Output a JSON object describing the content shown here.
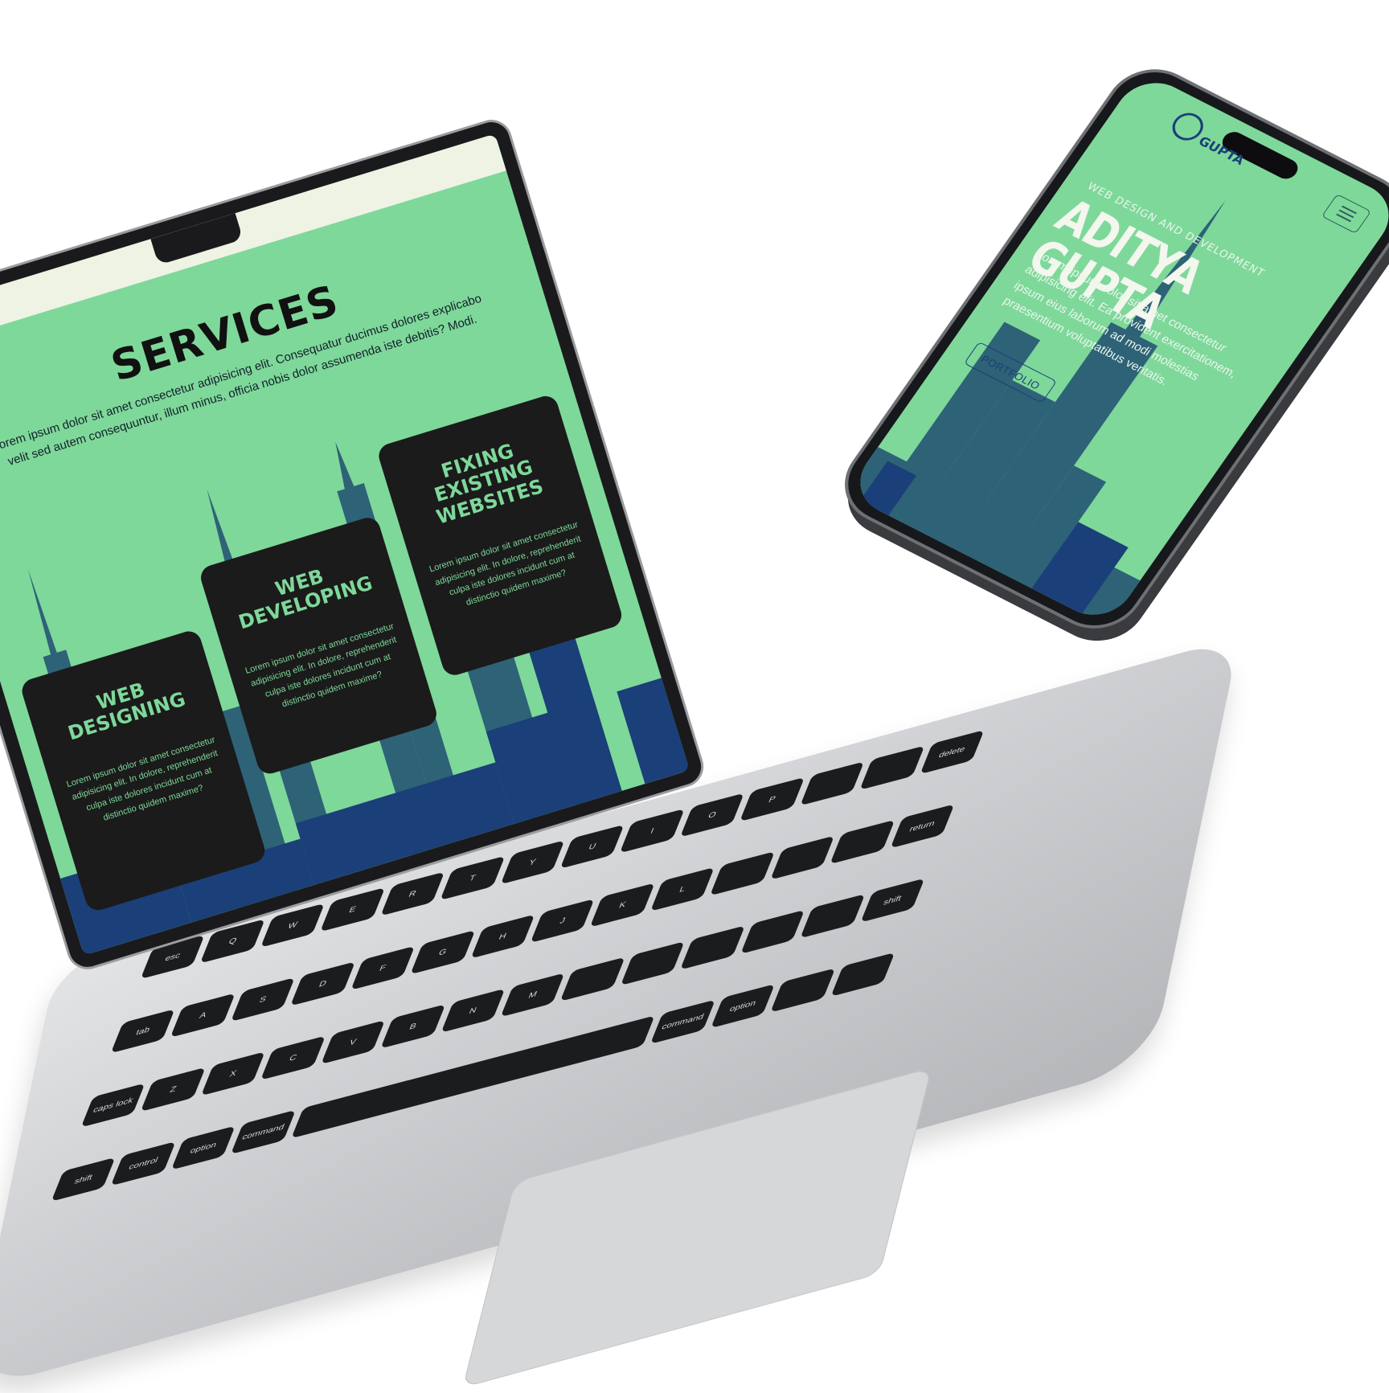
{
  "laptop": {
    "services": {
      "title": "SERVICES",
      "description": "Lorem ipsum dolor sit amet consectetur adipisicing elit. Consequatur ducimus dolores explicabo velit sed autem consequuntur, illum minus, officia nobis dolor assumenda iste debitis? Modi."
    },
    "cards": [
      {
        "title": "WEB DESIGNING",
        "text": "Lorem ipsum dolor sit amet consectetur adipisicing elit. In dolore, reprehenderit culpa iste dolores incidunt cum at distinctio quidem maxime?"
      },
      {
        "title": "WEB DEVELOPING",
        "text": "Lorem ipsum dolor sit amet consectetur adipisicing elit. In dolore, reprehenderit culpa iste dolores incidunt cum at distinctio quidem maxime?"
      },
      {
        "title": "FIXING EXISTING WEBSITES",
        "text": "Lorem ipsum dolor sit amet consectetur adipisicing elit. In dolore, reprehenderit culpa iste dolores incidunt cum at distinctio quidem maxime?"
      }
    ],
    "keys": [
      "esc",
      "tab",
      "caps lock",
      "shift",
      "control",
      "option",
      "command",
      "delete",
      "return",
      "shift",
      "option",
      "command",
      "Q",
      "W",
      "E",
      "R",
      "T",
      "Y",
      "U",
      "I",
      "O",
      "P",
      "A",
      "S",
      "D",
      "F",
      "G",
      "H",
      "J",
      "K",
      "L",
      "Z",
      "X",
      "C",
      "V",
      "B",
      "N",
      "M"
    ]
  },
  "phone": {
    "logo_text": "GUPTA",
    "subtitle": "WEB DESIGN AND DEVELOPMENT",
    "title": "ADITYA GUPTA",
    "description": "Lorem ipsum dolor sit amet consectetur adipisicing elit. Ea provident exercitationem, ipsum eius laborum ad modi molestias praesentium voluptatibus veritatis.",
    "portfolio_label": "PORTFOLIO",
    "menu_icon": "hamburger-icon"
  },
  "colors": {
    "accent_green": "#7ed89a",
    "card_dark": "#1b1b1b",
    "skyline_teal": "#2e6277",
    "skyline_navy": "#1b3f78"
  }
}
